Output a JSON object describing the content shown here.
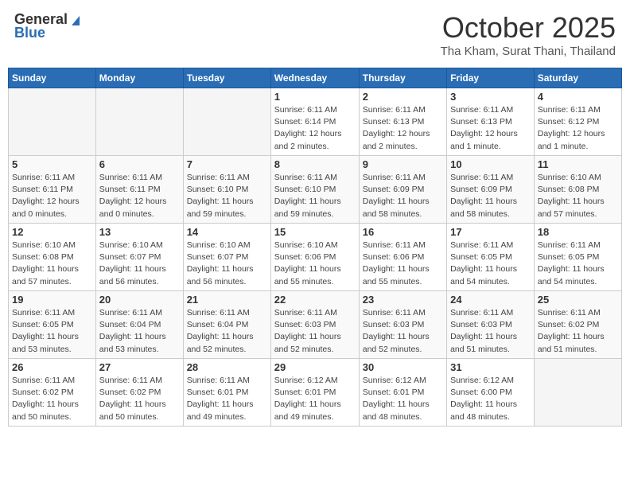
{
  "header": {
    "logo_general": "General",
    "logo_blue": "Blue",
    "month_title": "October 2025",
    "location": "Tha Kham, Surat Thani, Thailand"
  },
  "days_of_week": [
    "Sunday",
    "Monday",
    "Tuesday",
    "Wednesday",
    "Thursday",
    "Friday",
    "Saturday"
  ],
  "weeks": [
    [
      {
        "day": "",
        "info": ""
      },
      {
        "day": "",
        "info": ""
      },
      {
        "day": "",
        "info": ""
      },
      {
        "day": "1",
        "info": "Sunrise: 6:11 AM\nSunset: 6:14 PM\nDaylight: 12 hours\nand 2 minutes."
      },
      {
        "day": "2",
        "info": "Sunrise: 6:11 AM\nSunset: 6:13 PM\nDaylight: 12 hours\nand 2 minutes."
      },
      {
        "day": "3",
        "info": "Sunrise: 6:11 AM\nSunset: 6:13 PM\nDaylight: 12 hours\nand 1 minute."
      },
      {
        "day": "4",
        "info": "Sunrise: 6:11 AM\nSunset: 6:12 PM\nDaylight: 12 hours\nand 1 minute."
      }
    ],
    [
      {
        "day": "5",
        "info": "Sunrise: 6:11 AM\nSunset: 6:11 PM\nDaylight: 12 hours\nand 0 minutes."
      },
      {
        "day": "6",
        "info": "Sunrise: 6:11 AM\nSunset: 6:11 PM\nDaylight: 12 hours\nand 0 minutes."
      },
      {
        "day": "7",
        "info": "Sunrise: 6:11 AM\nSunset: 6:10 PM\nDaylight: 11 hours\nand 59 minutes."
      },
      {
        "day": "8",
        "info": "Sunrise: 6:11 AM\nSunset: 6:10 PM\nDaylight: 11 hours\nand 59 minutes."
      },
      {
        "day": "9",
        "info": "Sunrise: 6:11 AM\nSunset: 6:09 PM\nDaylight: 11 hours\nand 58 minutes."
      },
      {
        "day": "10",
        "info": "Sunrise: 6:11 AM\nSunset: 6:09 PM\nDaylight: 11 hours\nand 58 minutes."
      },
      {
        "day": "11",
        "info": "Sunrise: 6:10 AM\nSunset: 6:08 PM\nDaylight: 11 hours\nand 57 minutes."
      }
    ],
    [
      {
        "day": "12",
        "info": "Sunrise: 6:10 AM\nSunset: 6:08 PM\nDaylight: 11 hours\nand 57 minutes."
      },
      {
        "day": "13",
        "info": "Sunrise: 6:10 AM\nSunset: 6:07 PM\nDaylight: 11 hours\nand 56 minutes."
      },
      {
        "day": "14",
        "info": "Sunrise: 6:10 AM\nSunset: 6:07 PM\nDaylight: 11 hours\nand 56 minutes."
      },
      {
        "day": "15",
        "info": "Sunrise: 6:10 AM\nSunset: 6:06 PM\nDaylight: 11 hours\nand 55 minutes."
      },
      {
        "day": "16",
        "info": "Sunrise: 6:11 AM\nSunset: 6:06 PM\nDaylight: 11 hours\nand 55 minutes."
      },
      {
        "day": "17",
        "info": "Sunrise: 6:11 AM\nSunset: 6:05 PM\nDaylight: 11 hours\nand 54 minutes."
      },
      {
        "day": "18",
        "info": "Sunrise: 6:11 AM\nSunset: 6:05 PM\nDaylight: 11 hours\nand 54 minutes."
      }
    ],
    [
      {
        "day": "19",
        "info": "Sunrise: 6:11 AM\nSunset: 6:05 PM\nDaylight: 11 hours\nand 53 minutes."
      },
      {
        "day": "20",
        "info": "Sunrise: 6:11 AM\nSunset: 6:04 PM\nDaylight: 11 hours\nand 53 minutes."
      },
      {
        "day": "21",
        "info": "Sunrise: 6:11 AM\nSunset: 6:04 PM\nDaylight: 11 hours\nand 52 minutes."
      },
      {
        "day": "22",
        "info": "Sunrise: 6:11 AM\nSunset: 6:03 PM\nDaylight: 11 hours\nand 52 minutes."
      },
      {
        "day": "23",
        "info": "Sunrise: 6:11 AM\nSunset: 6:03 PM\nDaylight: 11 hours\nand 52 minutes."
      },
      {
        "day": "24",
        "info": "Sunrise: 6:11 AM\nSunset: 6:03 PM\nDaylight: 11 hours\nand 51 minutes."
      },
      {
        "day": "25",
        "info": "Sunrise: 6:11 AM\nSunset: 6:02 PM\nDaylight: 11 hours\nand 51 minutes."
      }
    ],
    [
      {
        "day": "26",
        "info": "Sunrise: 6:11 AM\nSunset: 6:02 PM\nDaylight: 11 hours\nand 50 minutes."
      },
      {
        "day": "27",
        "info": "Sunrise: 6:11 AM\nSunset: 6:02 PM\nDaylight: 11 hours\nand 50 minutes."
      },
      {
        "day": "28",
        "info": "Sunrise: 6:11 AM\nSunset: 6:01 PM\nDaylight: 11 hours\nand 49 minutes."
      },
      {
        "day": "29",
        "info": "Sunrise: 6:12 AM\nSunset: 6:01 PM\nDaylight: 11 hours\nand 49 minutes."
      },
      {
        "day": "30",
        "info": "Sunrise: 6:12 AM\nSunset: 6:01 PM\nDaylight: 11 hours\nand 48 minutes."
      },
      {
        "day": "31",
        "info": "Sunrise: 6:12 AM\nSunset: 6:00 PM\nDaylight: 11 hours\nand 48 minutes."
      },
      {
        "day": "",
        "info": ""
      }
    ]
  ]
}
